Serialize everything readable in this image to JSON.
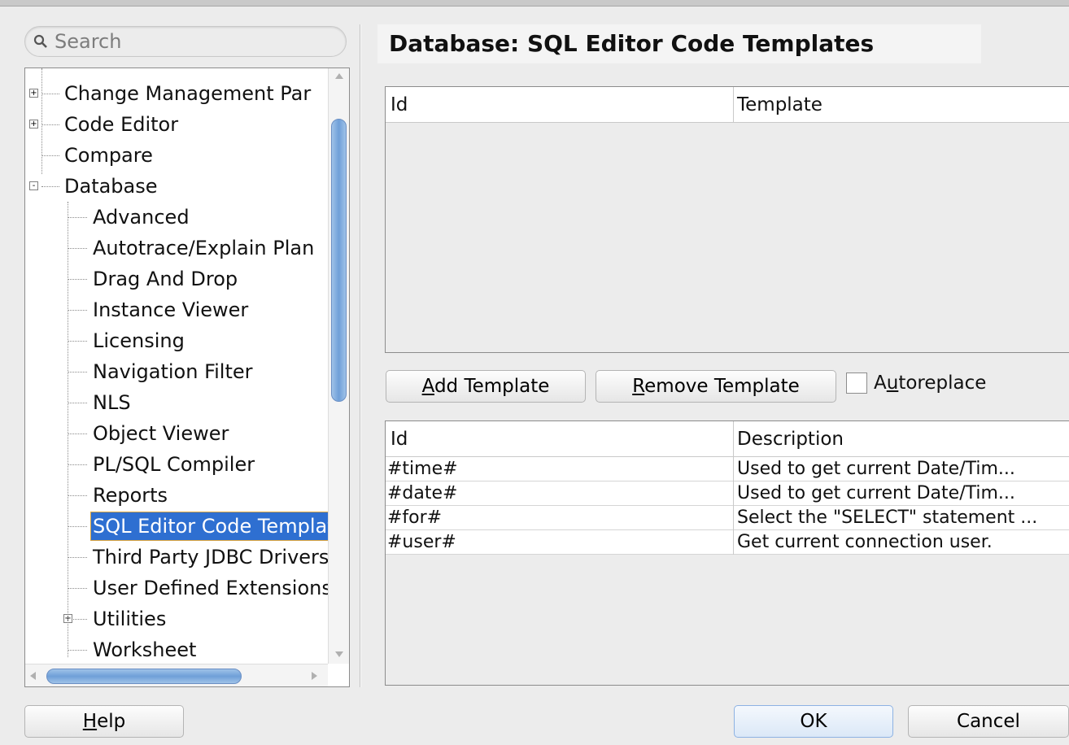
{
  "search": {
    "placeholder": "Search"
  },
  "tree": {
    "items": [
      {
        "label": "Change Management Par",
        "level": 0,
        "expander": "+"
      },
      {
        "label": "Code Editor",
        "level": 0,
        "expander": "+"
      },
      {
        "label": "Compare",
        "level": 0,
        "expander": ""
      },
      {
        "label": "Database",
        "level": 0,
        "expander": "-"
      },
      {
        "label": "Advanced",
        "level": 1,
        "expander": ""
      },
      {
        "label": "Autotrace/Explain Plan",
        "level": 1,
        "expander": ""
      },
      {
        "label": "Drag And Drop",
        "level": 1,
        "expander": ""
      },
      {
        "label": "Instance Viewer",
        "level": 1,
        "expander": ""
      },
      {
        "label": "Licensing",
        "level": 1,
        "expander": ""
      },
      {
        "label": "Navigation Filter",
        "level": 1,
        "expander": ""
      },
      {
        "label": "NLS",
        "level": 1,
        "expander": ""
      },
      {
        "label": "Object Viewer",
        "level": 1,
        "expander": ""
      },
      {
        "label": "PL/SQL Compiler",
        "level": 1,
        "expander": ""
      },
      {
        "label": "Reports",
        "level": 1,
        "expander": ""
      },
      {
        "label": "SQL Editor Code Templates",
        "level": 1,
        "expander": "",
        "selected": true
      },
      {
        "label": "Third Party JDBC Drivers",
        "level": 1,
        "expander": ""
      },
      {
        "label": "User Defined Extensions",
        "level": 1,
        "expander": ""
      },
      {
        "label": "Utilities",
        "level": 1,
        "expander": "+"
      },
      {
        "label": "Worksheet",
        "level": 1,
        "expander": ""
      }
    ]
  },
  "page": {
    "title": "Database: SQL Editor Code Templates"
  },
  "templates_table": {
    "col_id": "Id",
    "col_template": "Template"
  },
  "buttons": {
    "add_mn": "A",
    "add_rest": "dd Template",
    "remove_mn": "R",
    "remove_rest": "emove Template",
    "autoreplace_pre": "A",
    "autoreplace_mn": "u",
    "autoreplace_rest": "toreplace",
    "help_mn": "H",
    "help_rest": "elp",
    "ok": "OK",
    "cancel": "Cancel"
  },
  "variables_table": {
    "col_id": "Id",
    "col_description": "Description",
    "rows": [
      {
        "id": "#time#",
        "description": "Used to get current Date/Tim..."
      },
      {
        "id": "#date#",
        "description": "Used to get current Date/Tim..."
      },
      {
        "id": "#for#",
        "description": "Select the \"SELECT\" statement ..."
      },
      {
        "id": "#user#",
        "description": "Get current connection user."
      }
    ]
  },
  "colors": {
    "selection": "#2e6fd1",
    "selection_border": "#d9a440",
    "scroll_thumb": "#6f9fd8"
  }
}
